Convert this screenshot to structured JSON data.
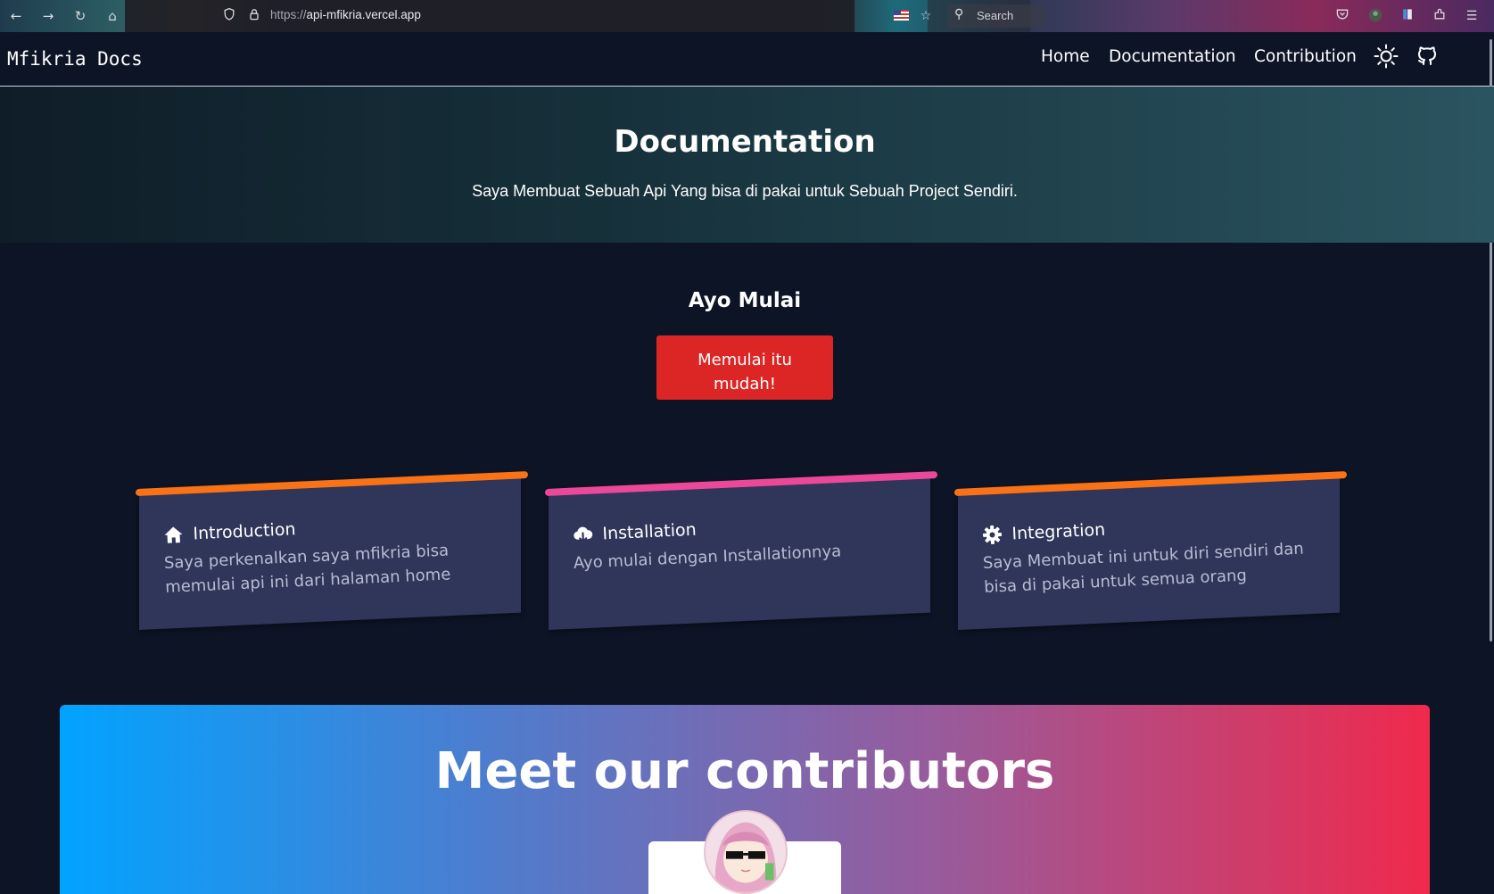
{
  "browser": {
    "url_protocol": "https://",
    "url_host": "api-mfikria.vercel.app",
    "search_label": "Search"
  },
  "nav": {
    "brand": "Mfikria Docs",
    "links": [
      "Home",
      "Documentation",
      "Contribution"
    ]
  },
  "hero": {
    "title": "Documentation",
    "subtitle": "Saya Membuat Sebuah Api Yang bisa di pakai untuk Sebuah Project Sendiri."
  },
  "start": {
    "title": "Ayo Mulai",
    "button_line1": "Memulai itu",
    "button_line2": "mudah!"
  },
  "cards": [
    {
      "title": "Introduction",
      "text": "Saya perkenalkan saya mfikria bisa memulai api ini dari halaman home",
      "icon": "home-icon",
      "accent": "#f97316"
    },
    {
      "title": "Installation",
      "text": "Ayo mulai dengan Installationnya",
      "icon": "cloud-download-icon",
      "accent": "#ec4899"
    },
    {
      "title": "Integration",
      "text": "Saya Membuat ini untuk diri sendiri dan bisa di pakai untuk semua orang",
      "icon": "gear-icon",
      "accent": "#f97316"
    }
  ],
  "contributors": {
    "title": "Meet our contributors"
  },
  "colors": {
    "background": "#0d1426",
    "primary_button": "#dc2626",
    "card_bg": "#30355a"
  }
}
